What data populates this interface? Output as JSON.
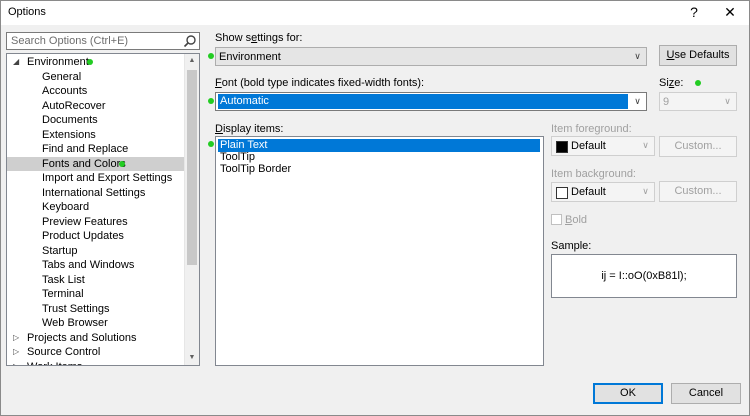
{
  "window": {
    "title": "Options",
    "help_glyph": "?",
    "close_glyph": "✕"
  },
  "search": {
    "placeholder": "Search Options (Ctrl+E)"
  },
  "tree": {
    "items": [
      {
        "label": "Environment",
        "level": 0,
        "expanded": true,
        "dot": true
      },
      {
        "label": "General",
        "level": 1
      },
      {
        "label": "Accounts",
        "level": 1
      },
      {
        "label": "AutoRecover",
        "level": 1
      },
      {
        "label": "Documents",
        "level": 1
      },
      {
        "label": "Extensions",
        "level": 1
      },
      {
        "label": "Find and Replace",
        "level": 1
      },
      {
        "label": "Fonts and Colors",
        "level": 1,
        "selected": true,
        "dot": true
      },
      {
        "label": "Import and Export Settings",
        "level": 1
      },
      {
        "label": "International Settings",
        "level": 1
      },
      {
        "label": "Keyboard",
        "level": 1
      },
      {
        "label": "Preview Features",
        "level": 1
      },
      {
        "label": "Product Updates",
        "level": 1
      },
      {
        "label": "Startup",
        "level": 1
      },
      {
        "label": "Tabs and Windows",
        "level": 1
      },
      {
        "label": "Task List",
        "level": 1
      },
      {
        "label": "Terminal",
        "level": 1
      },
      {
        "label": "Trust Settings",
        "level": 1
      },
      {
        "label": "Web Browser",
        "level": 1
      },
      {
        "label": "Projects and Solutions",
        "level": 0,
        "expanded": false
      },
      {
        "label": "Source Control",
        "level": 0,
        "expanded": false
      },
      {
        "label": "Work Items",
        "level": 0,
        "expanded": false
      }
    ]
  },
  "show_settings": {
    "label_pre": "Show s",
    "label_u": "e",
    "label_post": "ttings for:",
    "value": "Environment"
  },
  "use_defaults": {
    "label_u": "U",
    "label_post": "se Defaults"
  },
  "font": {
    "label_u": "F",
    "label_post": "ont (bold type indicates fixed-width fonts):",
    "value": "Automatic"
  },
  "size": {
    "label_pre": "Si",
    "label_u": "z",
    "label_post": "e:",
    "value": "9"
  },
  "display_items": {
    "label_u": "D",
    "label_post": "isplay items:",
    "items": [
      "Plain Text",
      "ToolTip",
      "ToolTip Border"
    ]
  },
  "item_foreground": {
    "label": "Item foreground:",
    "value": "Default",
    "swatch": "#000000"
  },
  "item_background": {
    "label": "Item background:",
    "value": "Default",
    "swatch": "#ffffff"
  },
  "custom_button": {
    "label": "Custom..."
  },
  "bold": {
    "label_u": "B",
    "label_post": "old"
  },
  "sample": {
    "label": "Sample:",
    "text": "ij = I::oO(0xB81l);"
  },
  "ok": {
    "label": "OK"
  },
  "cancel": {
    "label": "Cancel"
  },
  "colors": {
    "accent": "#0078d7",
    "indicator": "#22cc22",
    "tree_selection": "#cfcfcf"
  },
  "icons": {
    "search": "magnifier-icon",
    "expanded": "triangle-down-icon",
    "collapsed": "triangle-right-icon"
  }
}
